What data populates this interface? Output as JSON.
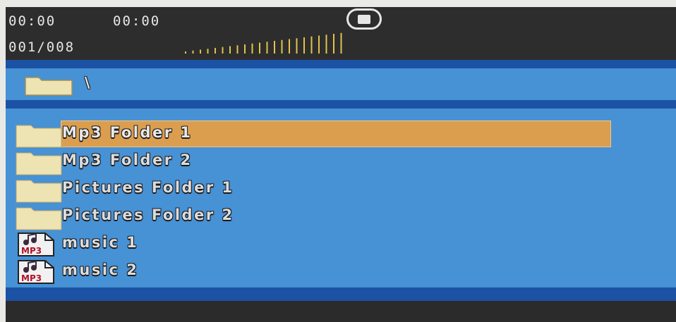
{
  "status": {
    "time_elapsed": "00:00",
    "time_total": "00:00",
    "track_counter": "001/008",
    "playback_state_icon": "stop-icon",
    "volume_meter": {
      "bars_total": 22,
      "bars_lit": 22,
      "color": "#e2c24a"
    }
  },
  "path": {
    "folder_icon": "folder-icon",
    "current_path": "\\"
  },
  "files": {
    "items": [
      {
        "label": "Mp3 Folder 1",
        "type": "folder",
        "icon": "folder-icon",
        "selected": true
      },
      {
        "label": "Mp3 Folder 2",
        "type": "folder",
        "icon": "folder-icon",
        "selected": false
      },
      {
        "label": "Pictures Folder 1",
        "type": "folder",
        "icon": "folder-icon",
        "selected": false
      },
      {
        "label": "Pictures Folder 2",
        "type": "folder",
        "icon": "folder-icon",
        "selected": false
      },
      {
        "label": "music 1",
        "type": "mp3",
        "icon": "mp3-file-icon",
        "selected": false
      },
      {
        "label": "music 2",
        "type": "mp3",
        "icon": "mp3-file-icon",
        "selected": false
      }
    ],
    "mp3_badge": "MP3"
  },
  "colors": {
    "osd_background": "#2b2b2b",
    "panel_blue": "#4791d5",
    "separator_blue": "#1c52a4",
    "highlight": "#db9e4e",
    "folder": "#eee3b2",
    "text": "#e6e6e6"
  }
}
